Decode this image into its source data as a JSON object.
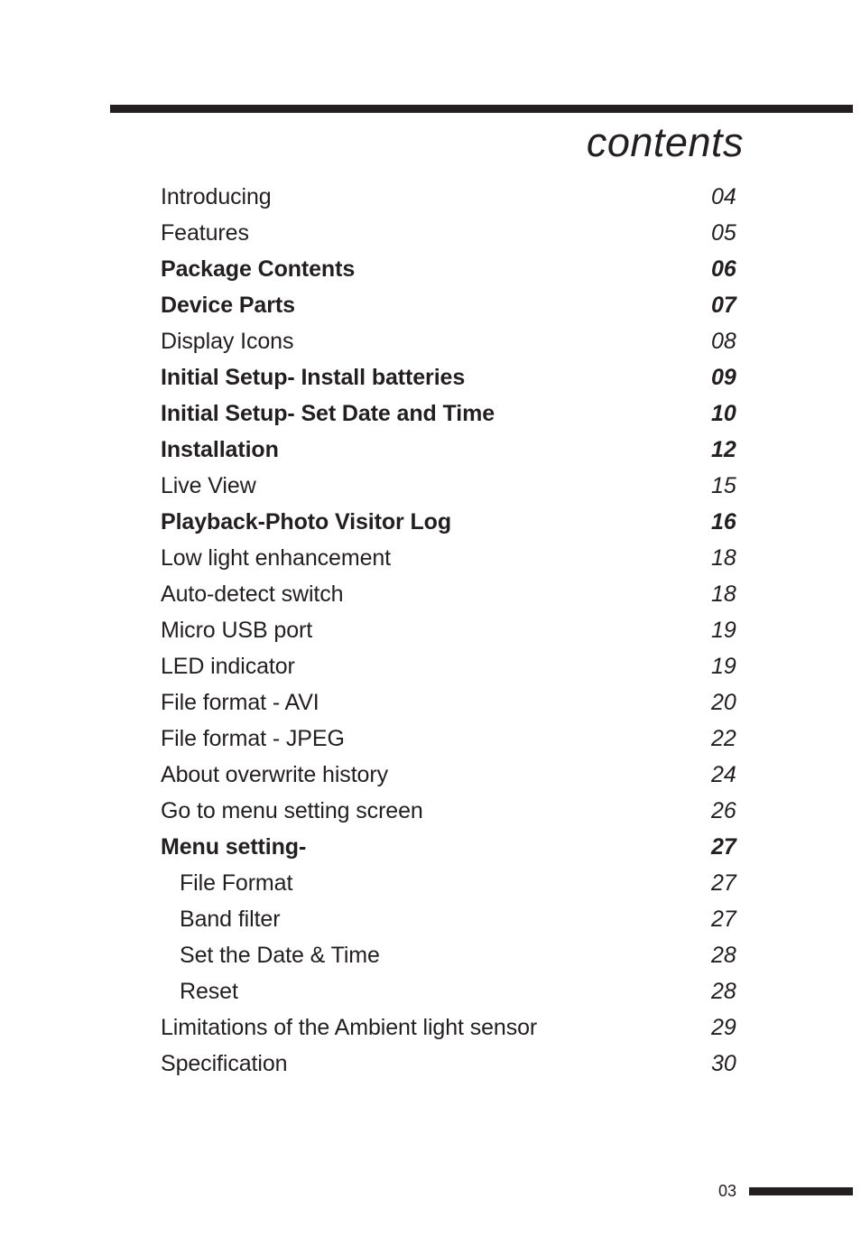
{
  "document": {
    "title": "contents",
    "footer_page_number": "03"
  },
  "toc": {
    "entries": [
      {
        "label": "Introducing",
        "page": "04",
        "bold": false,
        "sub": false
      },
      {
        "label": "Features",
        "page": "05",
        "bold": false,
        "sub": false
      },
      {
        "label": "Package Contents",
        "page": "06",
        "bold": true,
        "sub": false
      },
      {
        "label": "Device Parts",
        "page": "07",
        "bold": true,
        "sub": false
      },
      {
        "label": "Display Icons",
        "page": "08",
        "bold": false,
        "sub": false
      },
      {
        "label": "Initial Setup- Install batteries",
        "page": "09",
        "bold": true,
        "sub": false
      },
      {
        "label": "Initial Setup- Set Date and Time",
        "page": "10",
        "bold": true,
        "sub": false
      },
      {
        "label": "Installation",
        "page": "12",
        "bold": true,
        "sub": false
      },
      {
        "label": "Live View",
        "page": "15",
        "bold": false,
        "sub": false
      },
      {
        "label": "Playback-Photo Visitor Log",
        "page": "16",
        "bold": true,
        "sub": false
      },
      {
        "label": "Low light enhancement",
        "page": "18",
        "bold": false,
        "sub": false
      },
      {
        "label": "Auto-detect switch",
        "page": "18",
        "bold": false,
        "sub": false
      },
      {
        "label": "Micro USB port",
        "page": "19",
        "bold": false,
        "sub": false
      },
      {
        "label": "LED indicator",
        "page": "19",
        "bold": false,
        "sub": false
      },
      {
        "label": "File format - AVI",
        "page": "20",
        "bold": false,
        "sub": false
      },
      {
        "label": "File format - JPEG",
        "page": "22",
        "bold": false,
        "sub": false
      },
      {
        "label": "About overwrite history",
        "page": "24",
        "bold": false,
        "sub": false
      },
      {
        "label": "Go to menu setting screen",
        "page": "26",
        "bold": false,
        "sub": false
      },
      {
        "label": "Menu setting-",
        "page": "27",
        "bold": true,
        "sub": false
      },
      {
        "label": "File Format",
        "page": "27",
        "bold": false,
        "sub": true
      },
      {
        "label": "Band filter",
        "page": "27",
        "bold": false,
        "sub": true
      },
      {
        "label": "Set the Date & Time",
        "page": "28",
        "bold": false,
        "sub": true
      },
      {
        "label": "Reset",
        "page": "28",
        "bold": false,
        "sub": true
      },
      {
        "label": "Limitations of the Ambient light sensor",
        "page": "29",
        "bold": false,
        "sub": false
      },
      {
        "label": "Specification",
        "page": "30",
        "bold": false,
        "sub": false
      }
    ]
  },
  "colors": {
    "ink": "#231f20",
    "paper": "#ffffff"
  }
}
